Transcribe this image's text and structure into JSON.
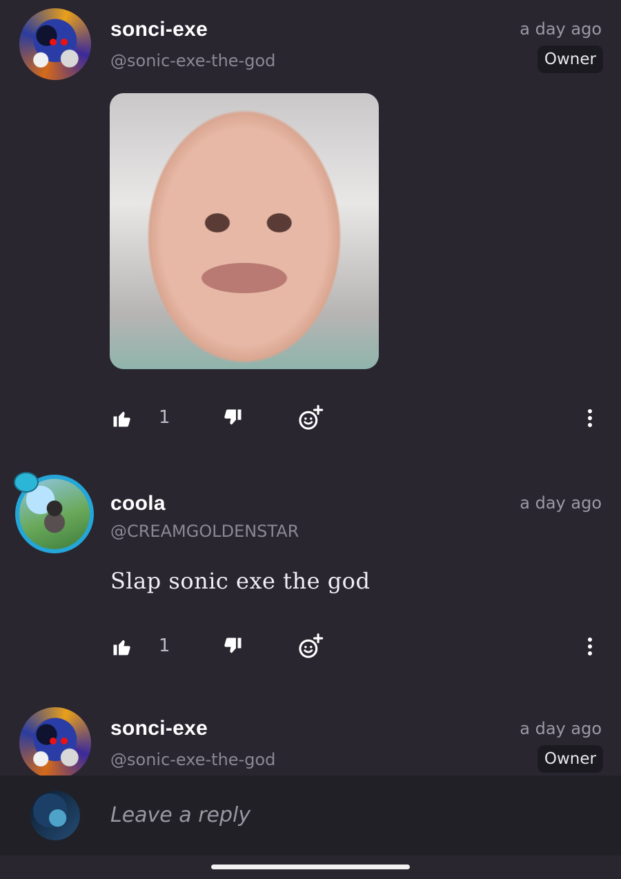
{
  "comments": [
    {
      "name": "sonci-exe",
      "handle": "@sonic-exe-the-god",
      "time": "a day ago",
      "badge": "Owner",
      "likes": "1",
      "media": "crying baby gif"
    },
    {
      "name": "coola",
      "handle": "@CREAMGOLDENSTAR",
      "time": "a day ago",
      "text": "Slap sonic exe the god",
      "likes": "1"
    },
    {
      "name": "sonci-exe",
      "handle": "@sonic-exe-the-god",
      "time": "a day ago",
      "badge": "Owner"
    }
  ],
  "reply": {
    "placeholder": "Leave a reply"
  },
  "icons": {
    "like": "thumbs-up-icon",
    "dislike": "thumbs-down-icon",
    "react": "add-reaction-icon",
    "more": "more-vertical-icon"
  },
  "colors": {
    "background": "#292630",
    "reply_bar": "#212026",
    "badge_bg": "#1c1a21",
    "muted_text": "#8b8894"
  }
}
